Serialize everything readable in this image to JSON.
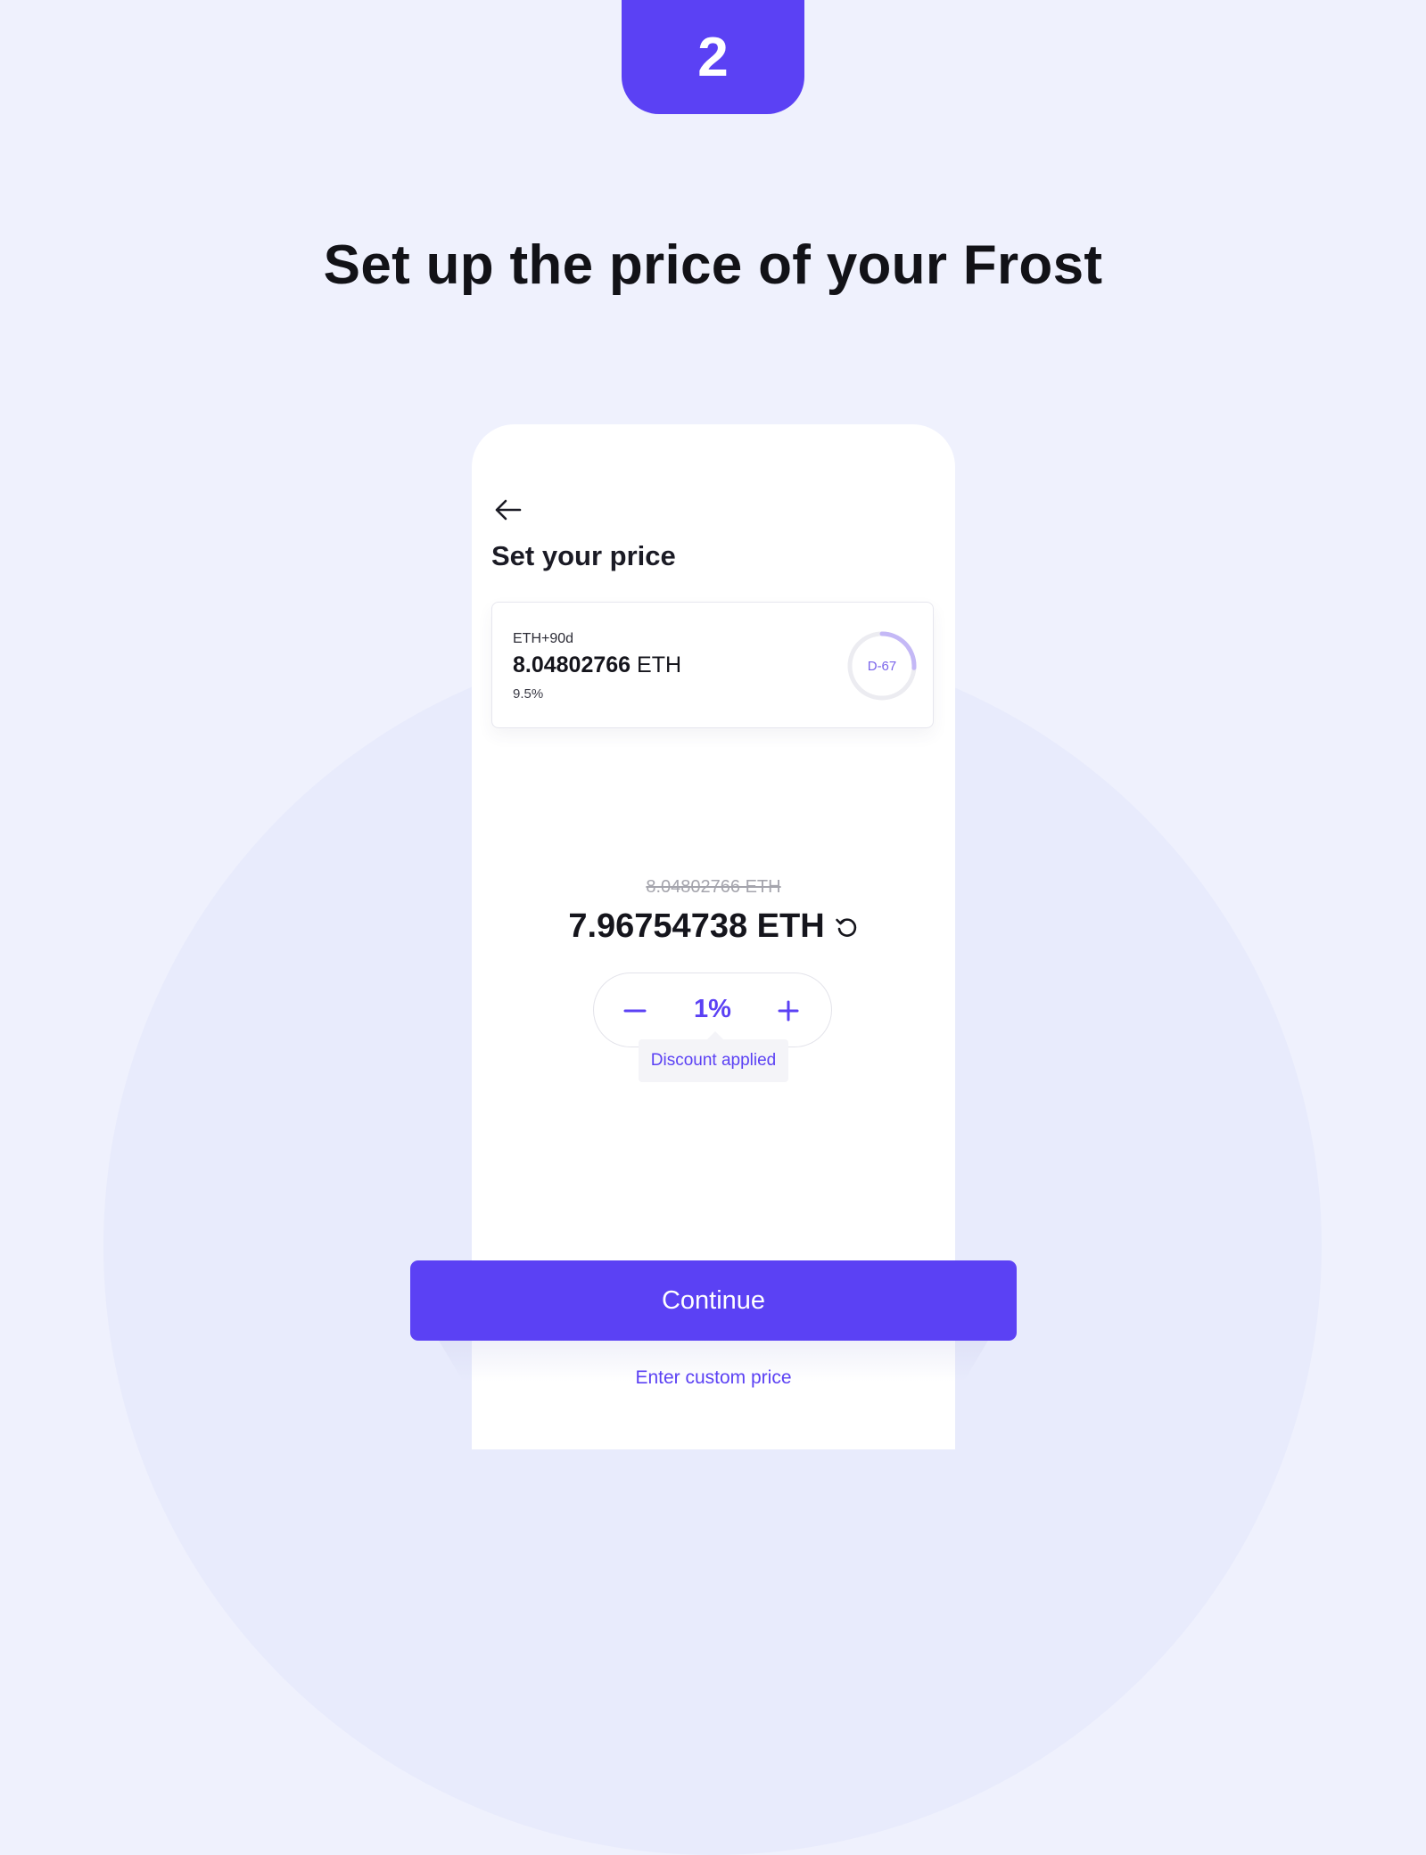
{
  "step": {
    "number": "2"
  },
  "headline": "Set up the price of your Frost",
  "screen": {
    "title": "Set your price",
    "back_icon": "arrow-left-icon",
    "asset": {
      "name": "ETH+90d",
      "price_value": "8.04802766",
      "price_unit": "ETH",
      "rate": "9.5%",
      "badge": "D-67",
      "badge_progress": 0.26
    },
    "original_price": "8.04802766 ETH",
    "new_price": "7.96754738 ETH",
    "reset_icon": "reset-icon",
    "stepper": {
      "value": "1%",
      "minus_icon": "minus-icon",
      "plus_icon": "plus-icon"
    },
    "tooltip": "Discount applied",
    "continue_label": "Continue",
    "custom_price_label": "Enter custom price"
  },
  "colors": {
    "background": "#eff1fd",
    "accent": "#5b41f4",
    "text": "#15151c",
    "muted": "#a5a5ad"
  }
}
